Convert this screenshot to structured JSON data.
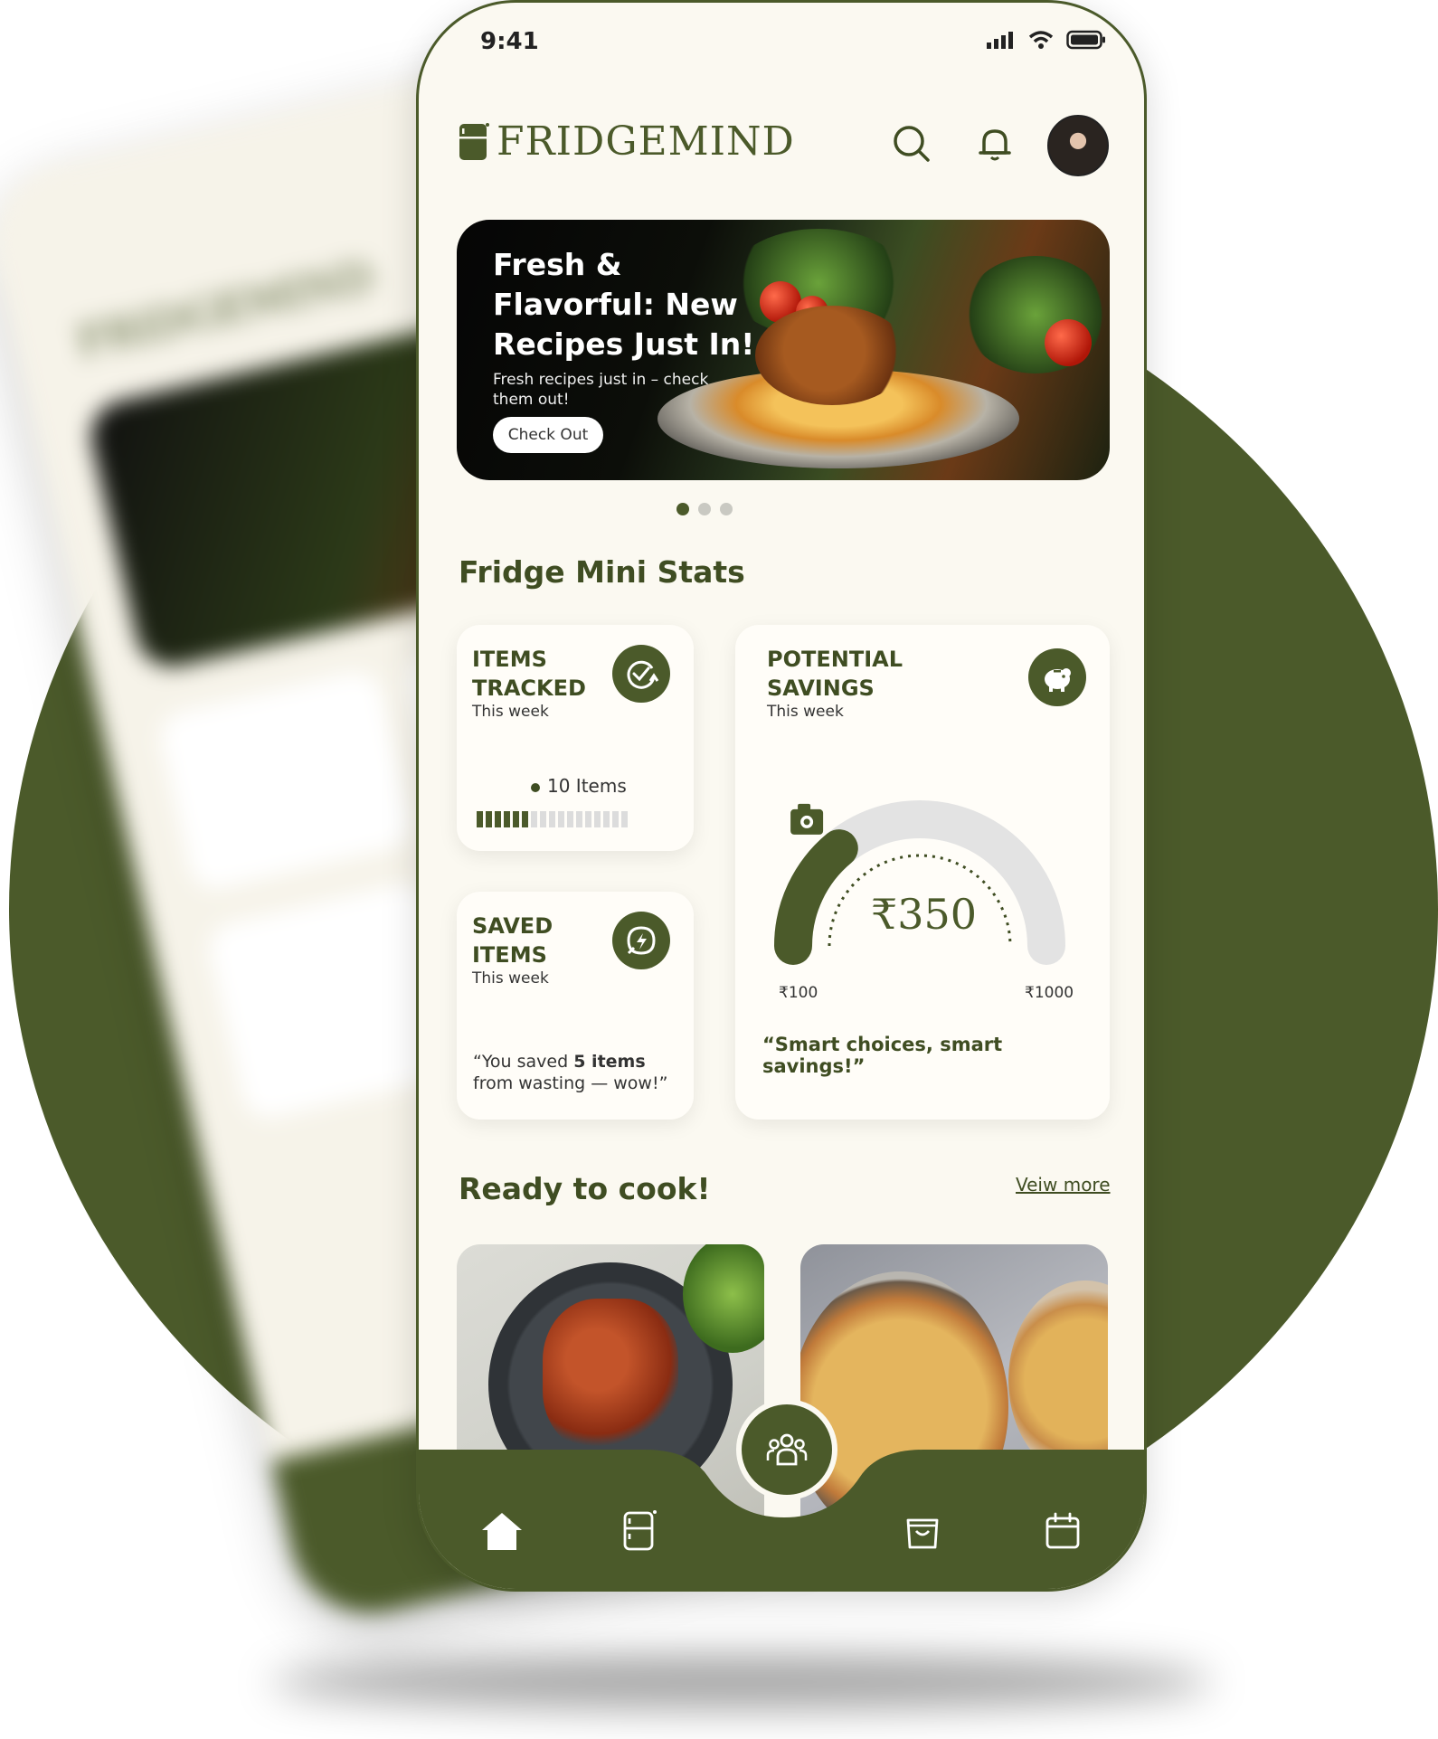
{
  "status": {
    "time": "9:41"
  },
  "app": {
    "name": "FRIDGEMIND"
  },
  "header": {
    "search_icon": "search-icon",
    "bell_icon": "bell-icon",
    "avatar": "user-avatar"
  },
  "banner": {
    "title": "Fresh & Flavorful: New Recipes Just In!",
    "subtitle": "Fresh recipes just in – check them out!",
    "button": "Check Out",
    "page_count": 3,
    "active_page": 1
  },
  "stats": {
    "title": "Fridge Mini Stats",
    "items_tracked": {
      "title": "ITEMS TRACKED",
      "period": "This week",
      "value": "10 Items",
      "progress_filled": 6,
      "progress_total": 17,
      "icon": "check-cycle-icon"
    },
    "saved_items": {
      "title": "SAVED ITEMS",
      "period": "This week",
      "quote_prefix": "“You saved ",
      "quote_bold": "5 items",
      "quote_suffix": " from wasting — wow!”",
      "icon": "leaf-bolt-icon"
    },
    "savings": {
      "title": "POTENTIAL SAVINGS",
      "period": "This week",
      "amount": "₹350",
      "min": "₹100",
      "max": "₹1000",
      "value_fraction": 0.28,
      "quote": "“Smart choices, smart savings!”",
      "icon": "piggy-bank-icon"
    }
  },
  "ready": {
    "title": "Ready to cook!",
    "view_more": "Veiw more"
  },
  "nav": {
    "items": [
      "home-icon",
      "fridge-icon",
      "community-icon",
      "shopping-bag-icon",
      "calendar-icon"
    ],
    "active": "home-icon"
  },
  "colors": {
    "primary": "#4b5a2a",
    "background": "#fbf9f1",
    "card": "#fffdf8"
  }
}
